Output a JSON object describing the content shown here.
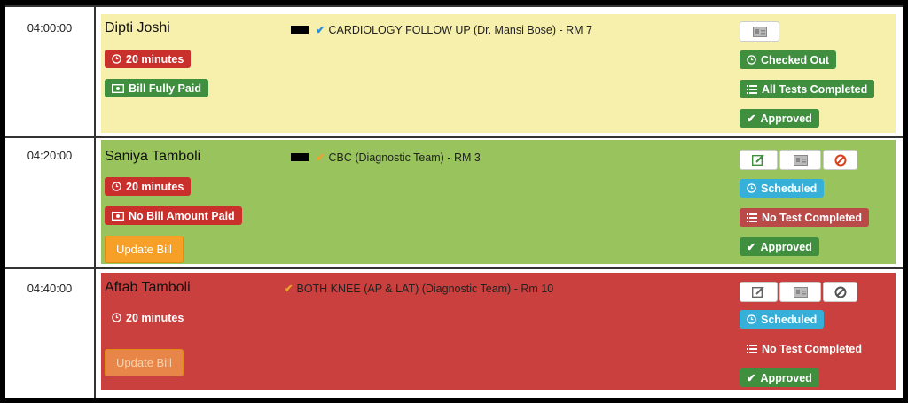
{
  "appointments": [
    {
      "time": "04:00:00",
      "patient": "Dipti Joshi",
      "service": "CARDIOLOGY FOLLOW UP (Dr. Mansi Bose) - RM 7",
      "duration": "20 minutes",
      "bill_status": "Bill Fully Paid",
      "status": "Checked Out",
      "tests": "All Tests Completed",
      "approval": "Approved",
      "card_color": "#f7efac"
    },
    {
      "time": "04:20:00",
      "patient": "Saniya Tamboli",
      "service": "CBC (Diagnostic Team) - RM 3",
      "duration": "20 minutes",
      "bill_status": "No Bill Amount Paid",
      "update_bill": "Update Bill",
      "status": "Scheduled",
      "tests": "No Test Completed",
      "approval": "Approved",
      "card_color": "#99c45d"
    },
    {
      "time": "04:40:00",
      "patient": "Aftab Tamboli",
      "service": "BOTH KNEE (AP & LAT) (Diagnostic Team) - Rm 10",
      "duration": "20 minutes",
      "update_bill": "Update Bill",
      "status": "Scheduled",
      "tests": "No Test Completed",
      "approval": "Approved",
      "card_color": "#c9403e"
    }
  ],
  "icons": [
    "clock-icon",
    "money-icon",
    "list-icon",
    "check-icon",
    "edit-icon",
    "id-card-icon",
    "ban-icon"
  ]
}
